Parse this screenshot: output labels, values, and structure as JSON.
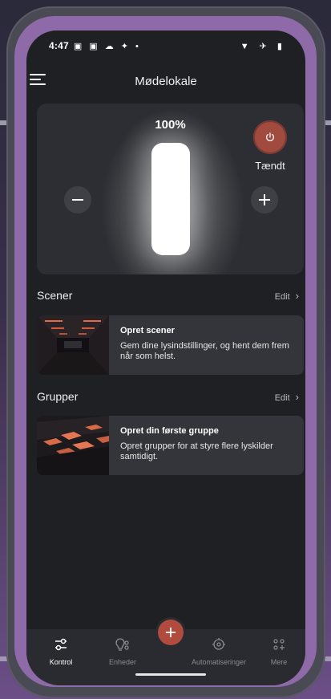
{
  "status_bar": {
    "time": "4:47",
    "left_icons": "▣ ▣ ☁ ✦ •",
    "right_icons": "▼ ✈ ▮"
  },
  "header": {
    "title": "Mødelokale"
  },
  "light_control": {
    "brightness": "100%",
    "level": 1.0,
    "power_label": "Tændt",
    "power_on": true
  },
  "scenes": {
    "label": "Scener",
    "edit_label": "Edit",
    "promo_title": "Opret scener",
    "promo_desc": "Gem dine lysindstillinger, og hent dem frem når som helst."
  },
  "groups": {
    "label": "Grupper",
    "edit_label": "Edit",
    "promo_title": "Opret din første gruppe",
    "promo_desc": "Opret grupper for at styre flere lyskilder samtidigt."
  },
  "bottom_nav": {
    "items": [
      {
        "label": "Kontrol",
        "icon": "sliders-icon",
        "active": true
      },
      {
        "label": "Enheder",
        "icon": "bulb-devices-icon",
        "active": false
      },
      {
        "label": "Automatiseringer",
        "icon": "automation-icon",
        "active": false
      },
      {
        "label": "Mere",
        "icon": "more-grid-icon",
        "active": false
      }
    ]
  },
  "colors": {
    "accent": "#b14b3e",
    "background": "#1f2024",
    "card": "#2d2e33",
    "frame": "#8f6aa8"
  }
}
